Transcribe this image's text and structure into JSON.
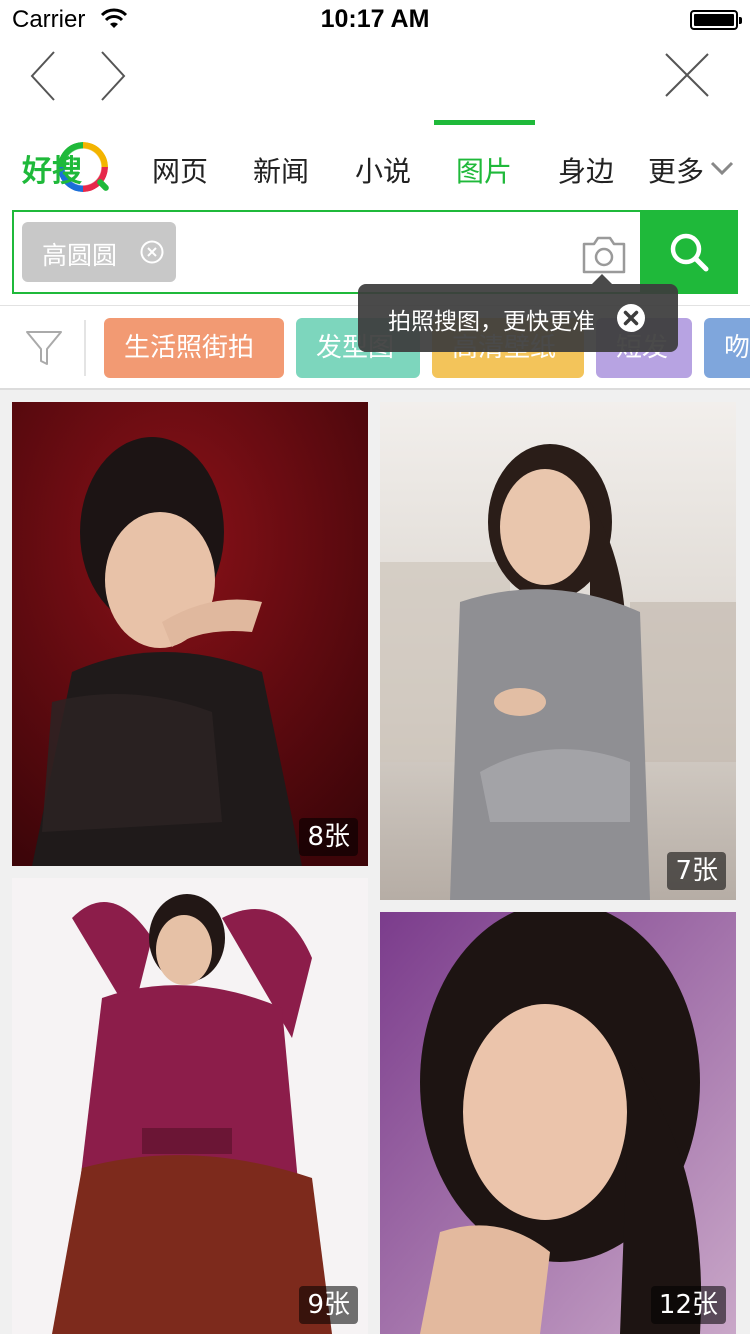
{
  "status_bar": {
    "carrier": "Carrier",
    "time": "10:17 AM"
  },
  "logo": {
    "text": "好搜"
  },
  "tabs": [
    {
      "label": "网页"
    },
    {
      "label": "新闻"
    },
    {
      "label": "小说"
    },
    {
      "label": "图片",
      "active": true
    },
    {
      "label": "身边"
    },
    {
      "label": "更多"
    }
  ],
  "search": {
    "chip_label": "高圆圆"
  },
  "tooltip": {
    "text": "拍照搜图，更快更准"
  },
  "tags": [
    {
      "label": "生活照街拍",
      "color": "#f29a73"
    },
    {
      "label": "发型图",
      "color": "#7dd6bd"
    },
    {
      "label": "高清壁纸",
      "color": "#f3c45a"
    },
    {
      "label": "短发",
      "color": "#b7a3e2"
    },
    {
      "label": "吻",
      "color": "#7fa6dc"
    }
  ],
  "images": [
    {
      "count": "8张",
      "icon": "portrait-photo"
    },
    {
      "count": "7张",
      "icon": "portrait-photo"
    },
    {
      "count": "9张",
      "icon": "portrait-photo"
    },
    {
      "count": "12张",
      "icon": "portrait-photo"
    }
  ],
  "colors": {
    "brand_green": "#1fb93a",
    "chip_gray": "#c8c8c8"
  }
}
